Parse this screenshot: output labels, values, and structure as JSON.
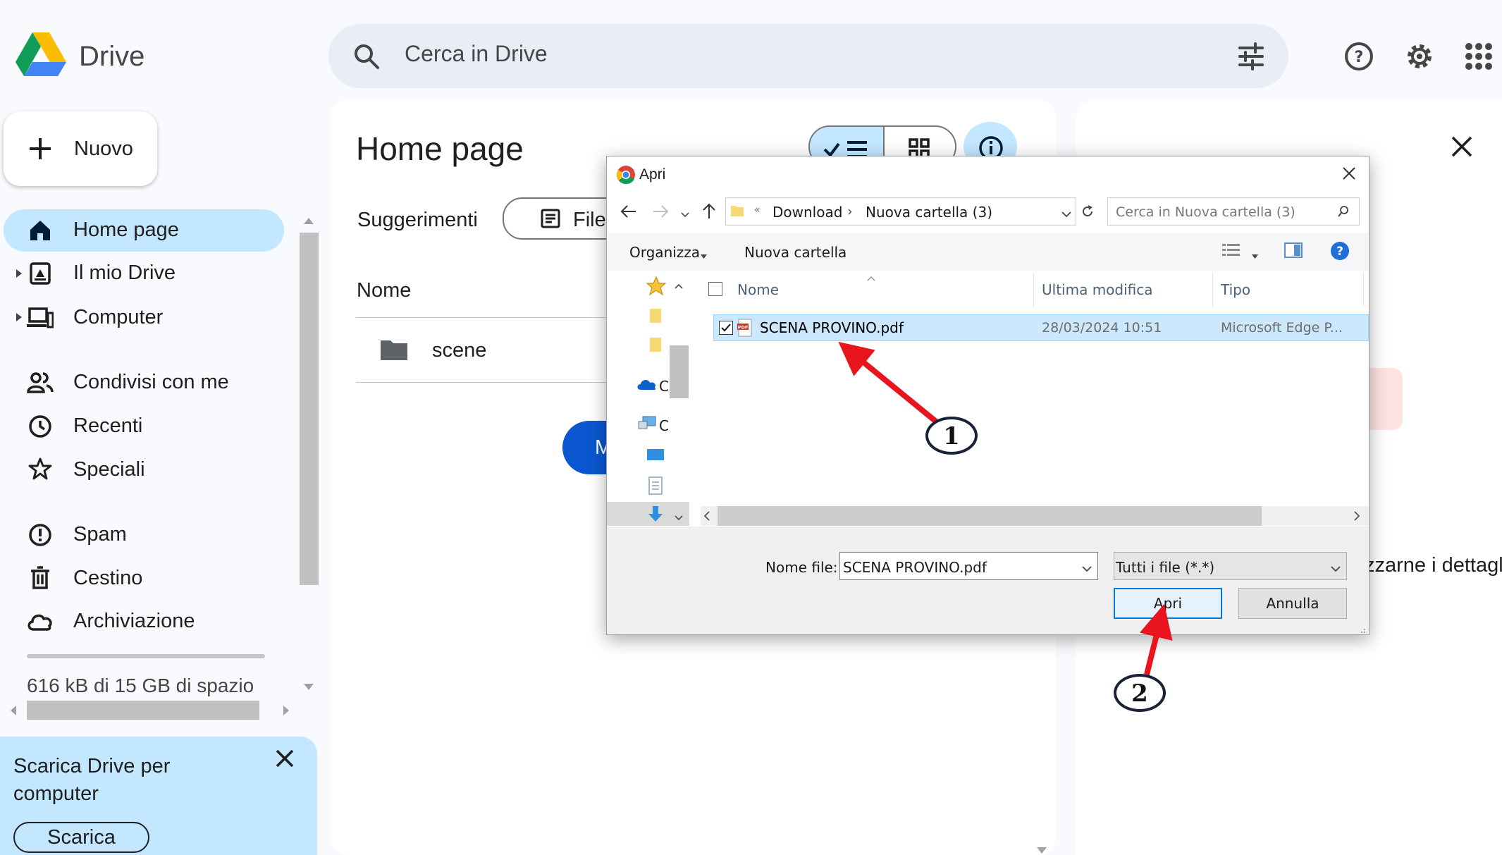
{
  "app": {
    "name": "Drive",
    "logo": "google-drive-logo",
    "search_placeholder": "Cerca in Drive",
    "icons": [
      "search-icon",
      "tune-icon",
      "help-icon",
      "settings-icon",
      "apps-grid-icon"
    ]
  },
  "sidebar": {
    "new_button": "Nuovo",
    "items": [
      {
        "label": "Home page",
        "icon": "home-icon",
        "active": true
      },
      {
        "label": "Il mio Drive",
        "icon": "my-drive-icon",
        "expandable": true
      },
      {
        "label": "Computer",
        "icon": "computer-icon",
        "expandable": true
      },
      {
        "label": "Condivisi con me",
        "icon": "shared-people-icon"
      },
      {
        "label": "Recenti",
        "icon": "clock-icon"
      },
      {
        "label": "Speciali",
        "icon": "star-icon"
      },
      {
        "label": "Spam",
        "icon": "spam-icon"
      },
      {
        "label": "Cestino",
        "icon": "trash-icon"
      },
      {
        "label": "Archiviazione",
        "icon": "cloud-icon"
      }
    ],
    "storage_text": "616 kB di 15 GB di spazio",
    "promo": {
      "title": "Scarica Drive per computer",
      "button": "Scarica"
    }
  },
  "main": {
    "title": "Home page",
    "suggestions_label": "Suggerimenti",
    "filter_chip": "File",
    "column_name": "Nome",
    "rows": [
      {
        "name": "scene",
        "icon": "folder-icon"
      }
    ],
    "blue_button_partial": "M"
  },
  "right_panel": {
    "partial_text": "zzarne i dettagl"
  },
  "dialog": {
    "title": "Apri",
    "breadcrumb": [
      "Download",
      "Nuova cartella (3)"
    ],
    "search_placeholder": "Cerca in Nuova cartella (3)",
    "organize": "Organizza",
    "new_folder": "Nuova cartella",
    "columns": [
      "Nome",
      "Ultima modifica",
      "Tipo"
    ],
    "files": [
      {
        "name": "SCENA PROVINO.pdf",
        "modified": "28/03/2024 10:51",
        "type": "Microsoft Edge P...",
        "selected": true
      }
    ],
    "nav_partial_labels": [
      "C",
      "C"
    ],
    "filename_label": "Nome file:",
    "filename_value": "SCENA PROVINO.pdf",
    "filter_value": "Tutti i file (*.*)",
    "open_button": "Apri",
    "cancel_button": "Annulla"
  },
  "annotations": {
    "step1": "1",
    "step2": "2",
    "arrow_color": "#e8141e"
  },
  "colors": {
    "active_nav": "#c2e7ff",
    "accent_blue": "#0b57d0",
    "selection": "#cce8ff"
  }
}
